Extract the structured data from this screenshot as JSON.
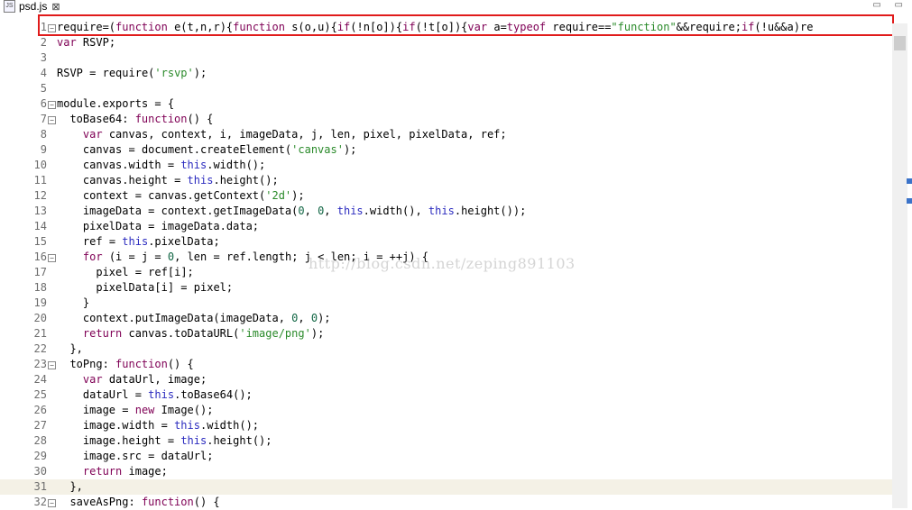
{
  "tab": {
    "title": "psd.js",
    "close_symbol": "⊠",
    "icon": "js-file-icon",
    "icon_text": "JS"
  },
  "watermark": "http://blog.csdn.net/zeping891103",
  "colors": {
    "highlight_box": "#e01b1b",
    "keyword": "#7f0055",
    "string": "#2a8a2a",
    "current_line": "#f4f1e6"
  },
  "lines": [
    {
      "n": "1",
      "text": "require=(function e(t,n,r){function s(o,u){if(!n[o]){if(!t[o]){var a=typeof require==\"function\"&&require;if(!u&&a)re",
      "fold": true
    },
    {
      "n": "2",
      "text": "var RSVP;"
    },
    {
      "n": "3",
      "text": ""
    },
    {
      "n": "4",
      "text": "RSVP = require('rsvp');"
    },
    {
      "n": "5",
      "text": ""
    },
    {
      "n": "6",
      "text": "module.exports = {",
      "fold": true
    },
    {
      "n": "7",
      "text": "  toBase64: function() {",
      "fold": true
    },
    {
      "n": "8",
      "text": "    var canvas, context, i, imageData, j, len, pixel, pixelData, ref;"
    },
    {
      "n": "9",
      "text": "    canvas = document.createElement('canvas');"
    },
    {
      "n": "10",
      "text": "    canvas.width = this.width();"
    },
    {
      "n": "11",
      "text": "    canvas.height = this.height();"
    },
    {
      "n": "12",
      "text": "    context = canvas.getContext('2d');"
    },
    {
      "n": "13",
      "text": "    imageData = context.getImageData(0, 0, this.width(), this.height());"
    },
    {
      "n": "14",
      "text": "    pixelData = imageData.data;"
    },
    {
      "n": "15",
      "text": "    ref = this.pixelData;"
    },
    {
      "n": "16",
      "text": "    for (i = j = 0, len = ref.length; j < len; i = ++j) {",
      "fold": true
    },
    {
      "n": "17",
      "text": "      pixel = ref[i];"
    },
    {
      "n": "18",
      "text": "      pixelData[i] = pixel;"
    },
    {
      "n": "19",
      "text": "    }"
    },
    {
      "n": "20",
      "text": "    context.putImageData(imageData, 0, 0);"
    },
    {
      "n": "21",
      "text": "    return canvas.toDataURL('image/png');"
    },
    {
      "n": "22",
      "text": "  },"
    },
    {
      "n": "23",
      "text": "  toPng: function() {",
      "fold": true
    },
    {
      "n": "24",
      "text": "    var dataUrl, image;"
    },
    {
      "n": "25",
      "text": "    dataUrl = this.toBase64();"
    },
    {
      "n": "26",
      "text": "    image = new Image();"
    },
    {
      "n": "27",
      "text": "    image.width = this.width();"
    },
    {
      "n": "28",
      "text": "    image.height = this.height();"
    },
    {
      "n": "29",
      "text": "    image.src = dataUrl;"
    },
    {
      "n": "30",
      "text": "    return image;"
    },
    {
      "n": "31",
      "text": "  },",
      "current": true
    },
    {
      "n": "32",
      "text": "  saveAsPng: function() {",
      "fold": true
    }
  ]
}
